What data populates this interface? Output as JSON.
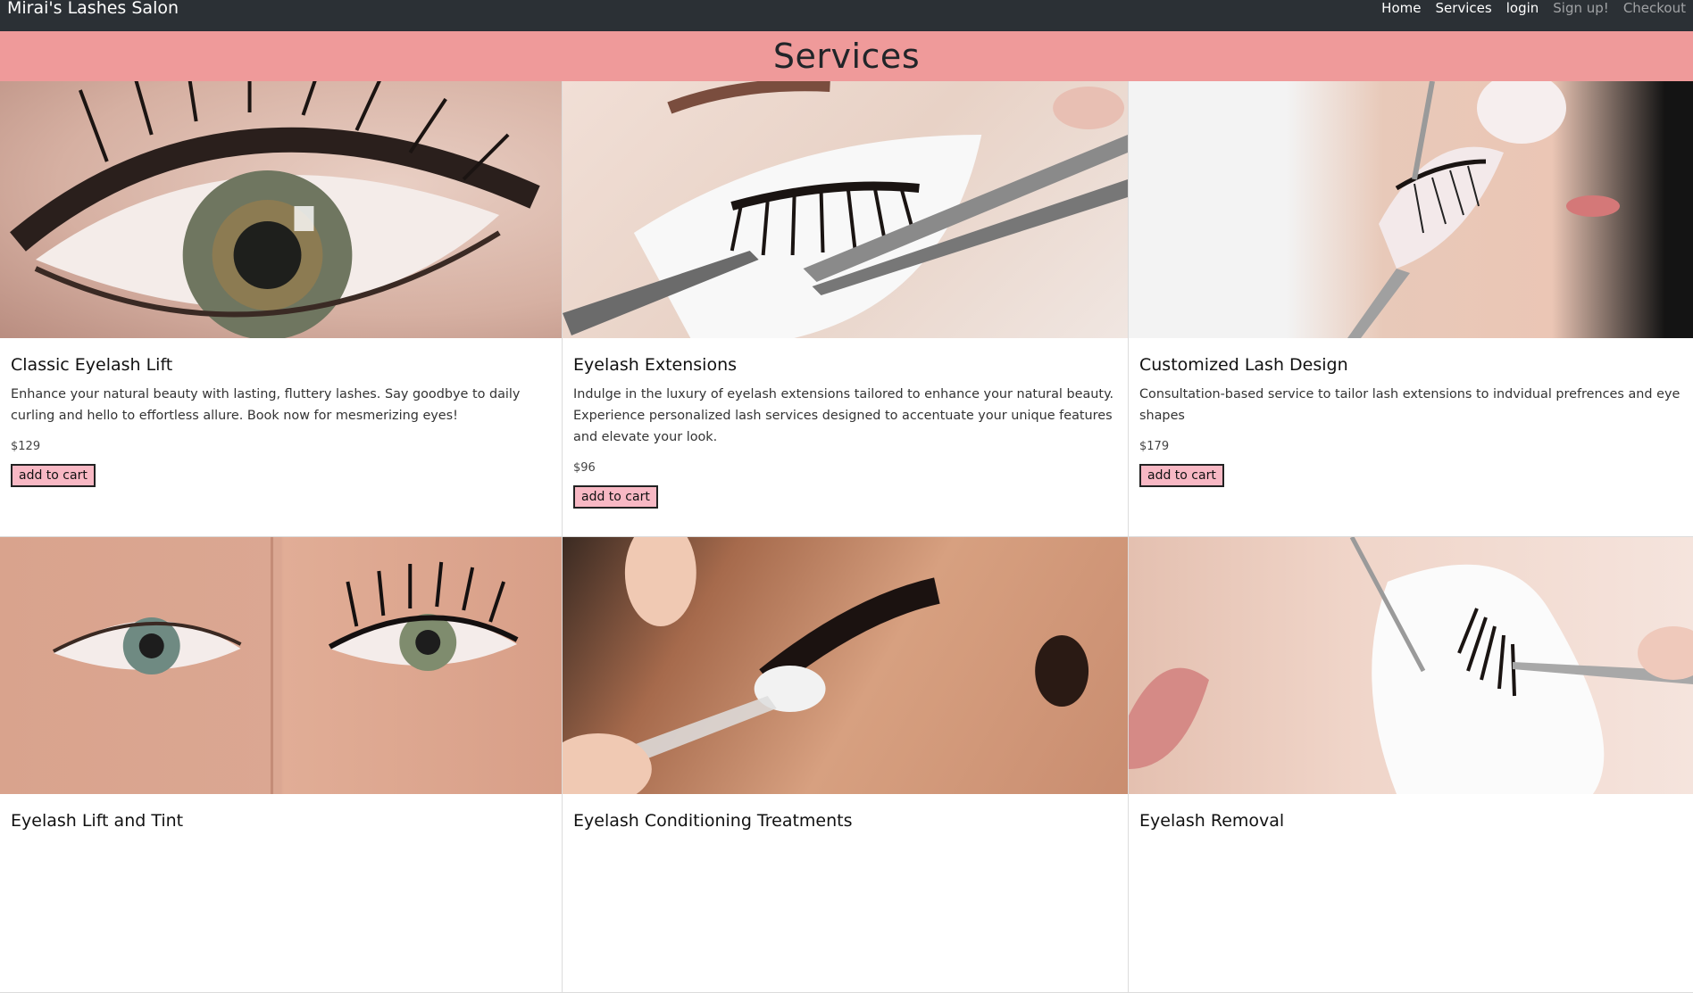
{
  "nav": {
    "brand": "Mirai's Lashes Salon",
    "links": [
      "Home",
      "Services",
      "login",
      "Sign up!",
      "Checkout"
    ]
  },
  "banner": {
    "title": "Services"
  },
  "services": [
    {
      "title": "Classic Eyelash Lift",
      "description": "Enhance your natural beauty with lasting, fluttery lashes. Say goodbye to daily curling and hello to effortless allure. Book now for mesmerizing eyes!",
      "price": "$129",
      "button": "add to cart"
    },
    {
      "title": "Eyelash Extensions",
      "description": "Indulge in the luxury of eyelash extensions tailored to enhance your natural beauty. Experience personalized lash services designed to accentuate your unique features and elevate your look.",
      "price": "$96",
      "button": "add to cart"
    },
    {
      "title": "Customized Lash Design",
      "description": "Consultation-based service to tailor lash extensions to indvidual prefrences and eye shapes",
      "price": "$179",
      "button": "add to cart"
    },
    {
      "title": "Eyelash Lift and Tint"
    },
    {
      "title": "Eyelash Conditioning Treatments"
    },
    {
      "title": "Eyelash Removal"
    }
  ]
}
